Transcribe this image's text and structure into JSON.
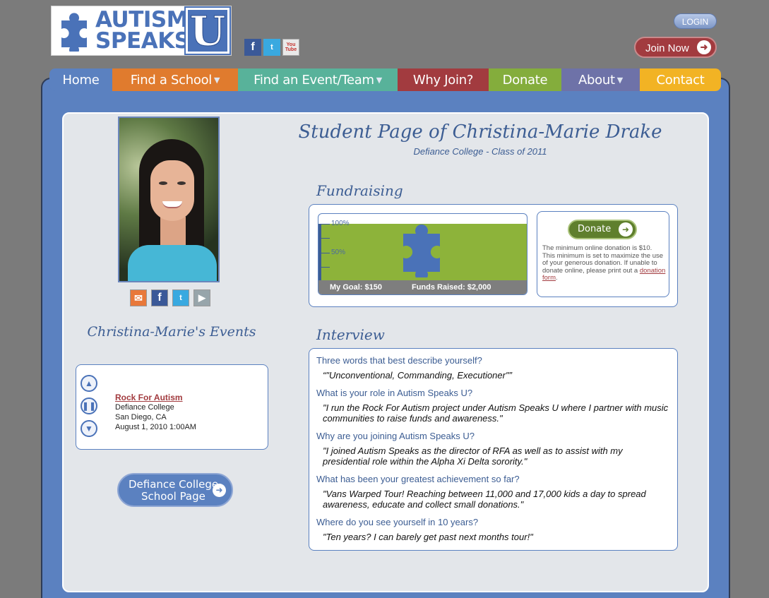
{
  "header": {
    "logo_line1": "AUTISM",
    "logo_line2": "SPEAKS",
    "logo_tm": "TM",
    "logo_u": "U",
    "login_label": "LOGIN",
    "join_label": "Join Now"
  },
  "social_icons": [
    "facebook-icon",
    "twitter-icon",
    "youtube-icon"
  ],
  "nav": [
    {
      "label": "Home",
      "color": "#5b81c0",
      "dropdown": false
    },
    {
      "label": "Find a School",
      "color": "#e07b2e",
      "dropdown": true
    },
    {
      "label": "Find an Event/Team",
      "color": "#58b29a",
      "dropdown": true
    },
    {
      "label": "Why Join?",
      "color": "#a23b3f",
      "dropdown": false
    },
    {
      "label": "Donate",
      "color": "#84ad3c",
      "dropdown": false
    },
    {
      "label": "About",
      "color": "#6e72a8",
      "dropdown": true
    },
    {
      "label": "Contact",
      "color": "#f2b324",
      "dropdown": false
    }
  ],
  "profile": {
    "share_icons": [
      "email-icon",
      "facebook-icon",
      "twitter-icon",
      "myspace-icon"
    ]
  },
  "events": {
    "title": "Christina-Marie's Events",
    "event_name": "Rock For Autism",
    "event_school": "Defiance College",
    "event_location": "San Diego, CA",
    "event_date": "August 1, 2010 1:00AM"
  },
  "school_button": {
    "line1": "Defiance College",
    "line2": "School Page"
  },
  "page": {
    "title": "Student Page of Christina-Marie Drake",
    "subtitle": "Defiance College - Class of 2011"
  },
  "fundraising": {
    "title": "Fundraising",
    "tick_100": "100%",
    "tick_50": "50%",
    "goal_label": "My Goal: $150",
    "raised_label": "Funds Raised: $2,000",
    "progress_fraction": 1.0,
    "donate_label": "Donate",
    "donate_text": "The minimum online donation is $10. This minimum is set to maximize the use of your generous donation. If unable to donate online, please print out a",
    "donate_link": "donation form",
    "donate_end": "."
  },
  "interview": {
    "title": "Interview",
    "items": [
      {
        "q": "Three words that best describe yourself?",
        "a": "“\"Unconventional, Commanding, Executioner\"”"
      },
      {
        "q": "What is your role in Autism Speaks U?",
        "a": "\"I run the Rock For Autism project under Autism Speaks U where I partner with music communities to raise funds and awareness.\""
      },
      {
        "q": "Why are you joining Autism Speaks U?",
        "a": "\"I joined Autism Speaks as the director of RFA as well as to assist with my presidential role within the Alpha Xi Delta sorority.\""
      },
      {
        "q": "What has been your greatest achievement so far?",
        "a": "\"Vans Warped Tour! Reaching between 11,000 and 17,000 kids a day to spread awareness, educate and collect small donations.\""
      },
      {
        "q": "Where do you see yourself in 10 years?",
        "a": "\"Ten years? I can barely get past next months tour!\""
      }
    ]
  },
  "colors": {
    "brand_blue": "#5b81c0",
    "accent_red": "#a23b3f",
    "fund_green": "#8db33a"
  }
}
